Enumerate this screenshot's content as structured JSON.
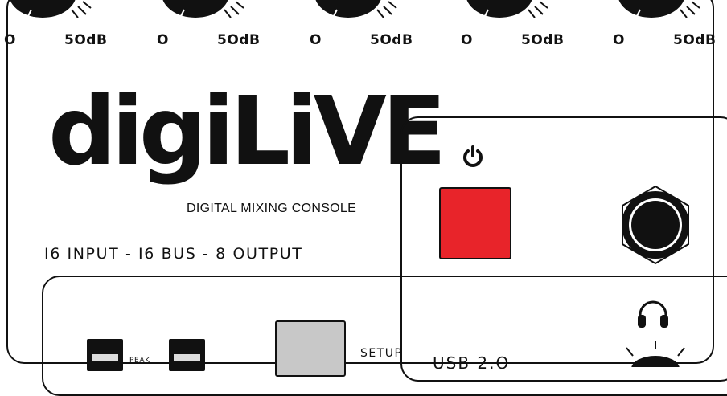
{
  "gain_knobs": [
    {
      "min_label": "O",
      "max_label": "5OdB"
    },
    {
      "min_label": "O",
      "max_label": "5OdB"
    },
    {
      "min_label": "O",
      "max_label": "5OdB"
    },
    {
      "min_label": "O",
      "max_label": "5OdB"
    },
    {
      "min_label": "O",
      "max_label": "5OdB"
    }
  ],
  "brand": {
    "logo_text": "digiLiVE",
    "subtitle": "DIGITAL MIXING CONSOLE",
    "spec_line": "I6 INPUT - I6 BUS - 8 OUTPUT"
  },
  "controls": {
    "power_icon": "power-icon",
    "headphone_icon": "headphone-icon",
    "peak_label": "PEAK",
    "setup_label": "SETUP",
    "usb_label": "USB 2.O"
  },
  "colors": {
    "power_button": "#e8242a",
    "setup_button": "#c8c8c8",
    "panel_line": "#111111"
  }
}
